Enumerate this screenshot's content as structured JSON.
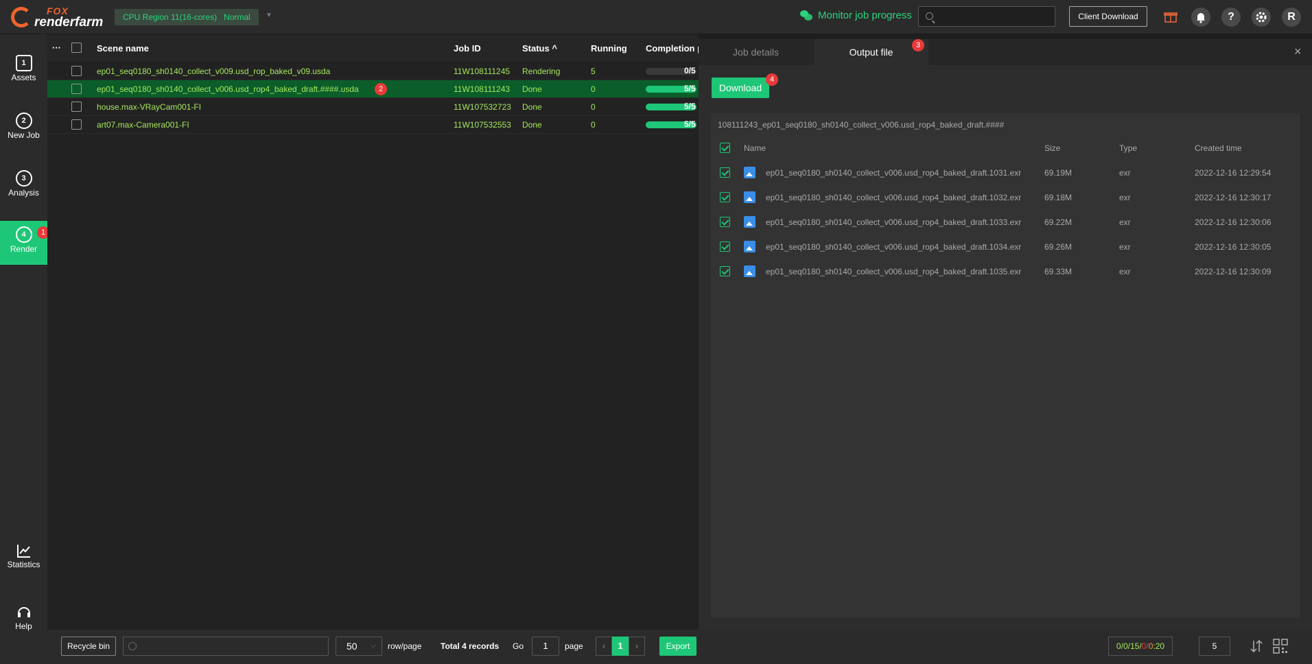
{
  "app": {
    "logo_fox": "FOX",
    "logo_renderfarm": "renderfarm"
  },
  "header": {
    "region_label": "CPU Region 11(16-cores)",
    "region_status": "Normal",
    "monitor_label": "Monitor job progress",
    "search_placeholder": "",
    "client_download": "Client Download",
    "help_glyph": "?",
    "user_initial": "R"
  },
  "sidebar": {
    "items": [
      {
        "label": "Assets",
        "icon": "assets-icon",
        "glyph": "1"
      },
      {
        "label": "New Job",
        "icon": "new-job-icon",
        "glyph": "2"
      },
      {
        "label": "Analysis",
        "icon": "analysis-icon",
        "glyph": "3"
      },
      {
        "label": "Render",
        "icon": "render-icon",
        "glyph": "4",
        "badge": "1"
      },
      {
        "label": "Statistics",
        "icon": "statistics-icon"
      },
      {
        "label": "Help",
        "icon": "help-icon"
      }
    ]
  },
  "jobs": {
    "more_glyph": "···",
    "columns": {
      "scene": "Scene name",
      "job_id": "Job ID",
      "status": "Status",
      "running": "Running",
      "completion": "Completion p"
    },
    "rows": [
      {
        "scene": "ep01_seq0180_sh0140_collect_v009.usd_rop_baked_v09.usda",
        "job_id": "11W108111245",
        "status": "Rendering",
        "running": "5",
        "completion": "0/5",
        "progress": 0
      },
      {
        "scene": "ep01_seq0180_sh0140_collect_v006.usd_rop4_baked_draft.####.usda",
        "job_id": "11W108111243",
        "status": "Done",
        "running": "0",
        "completion": "5/5",
        "progress": 1,
        "badge": "2"
      },
      {
        "scene": "house.max-VRayCam001-FI",
        "job_id": "11W107532723",
        "status": "Done",
        "running": "0",
        "completion": "5/5",
        "progress": 1
      },
      {
        "scene": "art07.max-Camera001-FI",
        "job_id": "11W107532553",
        "status": "Done",
        "running": "0",
        "completion": "5/5",
        "progress": 1
      }
    ]
  },
  "panel": {
    "tab_details": "Job details",
    "tab_output": "Output file",
    "tab_output_badge": "3",
    "close_glyph": "×",
    "download": "Download",
    "download_badge": "4",
    "folder": "108111243_ep01_seq0180_sh0140_collect_v006.usd_rop4_baked_draft.####",
    "columns": {
      "name": "Name",
      "size": "Size",
      "type": "Type",
      "created": "Created time"
    },
    "files": [
      {
        "name": "ep01_seq0180_sh0140_collect_v006.usd_rop4_baked_draft.1031.exr",
        "size": "69.19M",
        "type": "exr",
        "created": "2022-12-16 12:29:54"
      },
      {
        "name": "ep01_seq0180_sh0140_collect_v006.usd_rop4_baked_draft.1032.exr",
        "size": "69.18M",
        "type": "exr",
        "created": "2022-12-16 12:30:17"
      },
      {
        "name": "ep01_seq0180_sh0140_collect_v006.usd_rop4_baked_draft.1033.exr",
        "size": "69.22M",
        "type": "exr",
        "created": "2022-12-16 12:30:06"
      },
      {
        "name": "ep01_seq0180_sh0140_collect_v006.usd_rop4_baked_draft.1034.exr",
        "size": "69.26M",
        "type": "exr",
        "created": "2022-12-16 12:30:05"
      },
      {
        "name": "ep01_seq0180_sh0140_collect_v006.usd_rop4_baked_draft.1035.exr",
        "size": "69.33M",
        "type": "exr",
        "created": "2022-12-16 12:30:09"
      }
    ]
  },
  "footer": {
    "recycle_bin": "Recycle bin",
    "page_size": "50",
    "rows_per_page": "row/page",
    "total": "Total 4 records",
    "go": "Go",
    "page_input": "1",
    "page_label": "page",
    "current_page": "1",
    "prev_glyph": "‹",
    "next_glyph": "›",
    "export": "Export",
    "counts": {
      "a": "0",
      "b": "0",
      "c": "15",
      "d": "0",
      "e": "0",
      "f": "20"
    },
    "count_input": "5"
  },
  "colors": {
    "accent": "#1ec777",
    "badge": "#e83a3a",
    "job_text": "#a6e65e",
    "brand": "#f0642d"
  }
}
